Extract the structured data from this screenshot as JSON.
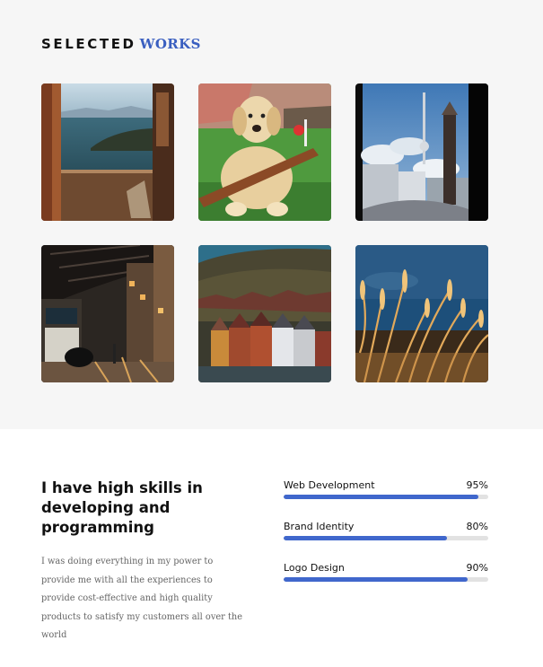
{
  "works": {
    "title_bold": "SELECTED",
    "title_light": "WORKS",
    "items": [
      {
        "subject": "balcony-sea-view"
      },
      {
        "subject": "dog-with-stick"
      },
      {
        "subject": "tv-tower-city"
      },
      {
        "subject": "rainy-street-night"
      },
      {
        "subject": "colorful-harbor-houses"
      },
      {
        "subject": "golden-grass-water"
      }
    ]
  },
  "skills": {
    "heading": "I have high skills in developing and programming",
    "description": "I was doing everything in my power to provide me with all the experiences to provide cost-effective and high quality products to satisfy my customers all over the world",
    "items": [
      {
        "name": "Web Development",
        "percent_label": "95%",
        "value": 0.95
      },
      {
        "name": "Brand Identity",
        "percent_label": "80%",
        "value": 0.8
      },
      {
        "name": "Logo Design",
        "percent_label": "90%",
        "value": 0.9
      }
    ],
    "bar_color": "#4067cc",
    "track_color": "#e2e2e2"
  }
}
